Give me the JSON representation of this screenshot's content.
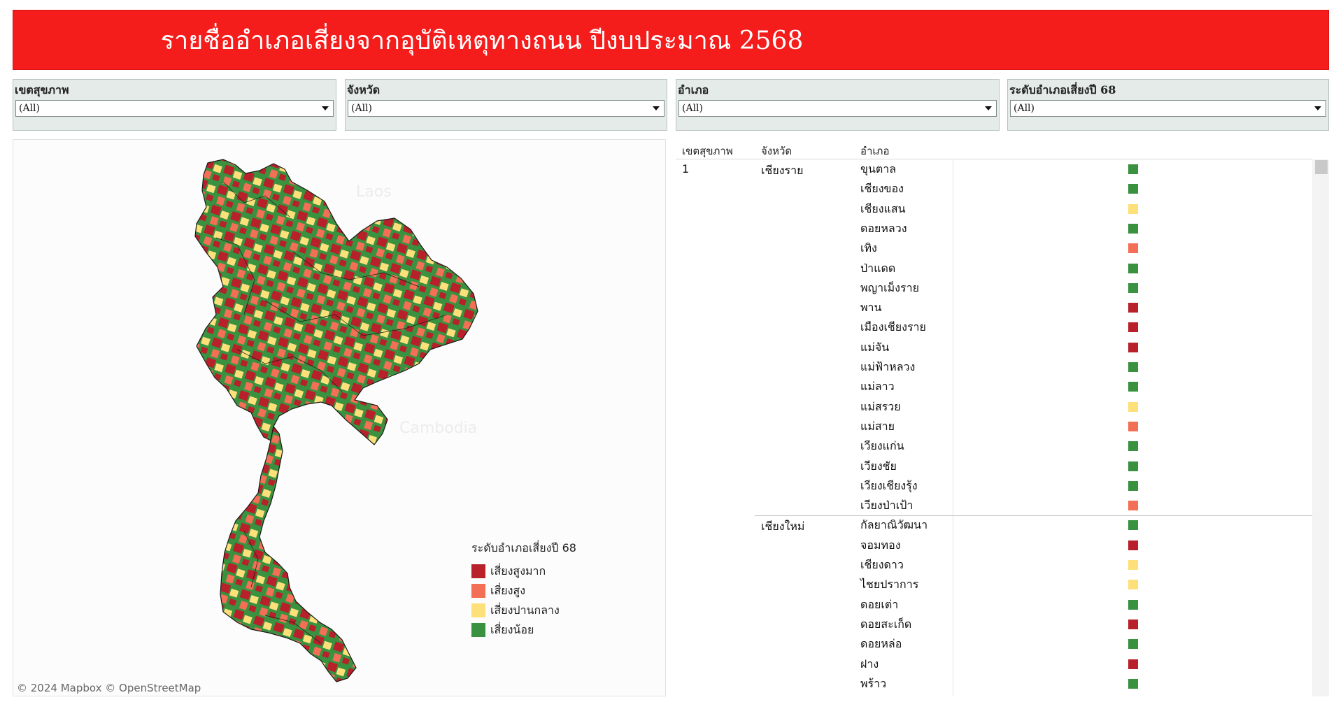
{
  "header": {
    "title": "รายชื่ออำเภอเสี่ยงจากอุบัติเหตุทางถนน ปีงบประมาณ 2568",
    "background": "#f51c1c"
  },
  "filters": [
    {
      "label": "เขตสุขภาพ",
      "value": "(All)"
    },
    {
      "label": "จังหวัด",
      "value": "(All)"
    },
    {
      "label": "อำเภอ",
      "value": "(All)"
    },
    {
      "label": "ระดับอำเภอเสี่ยงปี 68",
      "value": "(All)"
    }
  ],
  "map": {
    "ghost_labels": [
      "Laos",
      "Cambodia"
    ],
    "attribution": "© 2024 Mapbox  © OpenStreetMap",
    "legend": {
      "title": "ระดับอำเภอเสี่ยงปี 68",
      "items": [
        {
          "label": "เสี่ยงสูงมาก",
          "color": "#b8202a"
        },
        {
          "label": "เสี่ยงสูง",
          "color": "#f36f55"
        },
        {
          "label": "เสี่ยงปานกลาง",
          "color": "#fde07a"
        },
        {
          "label": "เสี่ยงน้อย",
          "color": "#3a913f"
        }
      ]
    }
  },
  "table": {
    "columns": [
      "เขตสุขภาพ",
      "จังหวัด",
      "อำเภอ"
    ],
    "groups": [
      {
        "region": "1",
        "province": "เชียงราย",
        "rows": [
          {
            "district": "ขุนตาล",
            "level": "เสี่ยงน้อย"
          },
          {
            "district": "เชียงของ",
            "level": "เสี่ยงน้อย"
          },
          {
            "district": "เชียงแสน",
            "level": "เสี่ยงปานกลาง"
          },
          {
            "district": "ดอยหลวง",
            "level": "เสี่ยงน้อย"
          },
          {
            "district": "เทิง",
            "level": "เสี่ยงสูง"
          },
          {
            "district": "ป่าแดด",
            "level": "เสี่ยงน้อย"
          },
          {
            "district": "พญาเม็งราย",
            "level": "เสี่ยงน้อย"
          },
          {
            "district": "พาน",
            "level": "เสี่ยงสูงมาก"
          },
          {
            "district": "เมืองเชียงราย",
            "level": "เสี่ยงสูงมาก"
          },
          {
            "district": "แม่จัน",
            "level": "เสี่ยงสูงมาก"
          },
          {
            "district": "แม่ฟ้าหลวง",
            "level": "เสี่ยงน้อย"
          },
          {
            "district": "แม่ลาว",
            "level": "เสี่ยงน้อย"
          },
          {
            "district": "แม่สรวย",
            "level": "เสี่ยงปานกลาง"
          },
          {
            "district": "แม่สาย",
            "level": "เสี่ยงสูง"
          },
          {
            "district": "เวียงแก่น",
            "level": "เสี่ยงน้อย"
          },
          {
            "district": "เวียงชัย",
            "level": "เสี่ยงน้อย"
          },
          {
            "district": "เวียงเชียงรุ้ง",
            "level": "เสี่ยงน้อย"
          },
          {
            "district": "เวียงป่าเป้า",
            "level": "เสี่ยงสูง"
          }
        ]
      },
      {
        "region": "",
        "province": "เชียงใหม่",
        "rows": [
          {
            "district": "กัลยาณิวัฒนา",
            "level": "เสี่ยงน้อย"
          },
          {
            "district": "จอมทอง",
            "level": "เสี่ยงสูงมาก"
          },
          {
            "district": "เชียงดาว",
            "level": "เสี่ยงปานกลาง"
          },
          {
            "district": "ไชยปราการ",
            "level": "เสี่ยงปานกลาง"
          },
          {
            "district": "ดอยเต่า",
            "level": "เสี่ยงน้อย"
          },
          {
            "district": "ดอยสะเก็ด",
            "level": "เสี่ยงสูงมาก"
          },
          {
            "district": "ดอยหล่อ",
            "level": "เสี่ยงน้อย"
          },
          {
            "district": "ฝาง",
            "level": "เสี่ยงสูงมาก"
          },
          {
            "district": "พร้าว",
            "level": "เสี่ยงน้อย"
          }
        ]
      }
    ]
  }
}
